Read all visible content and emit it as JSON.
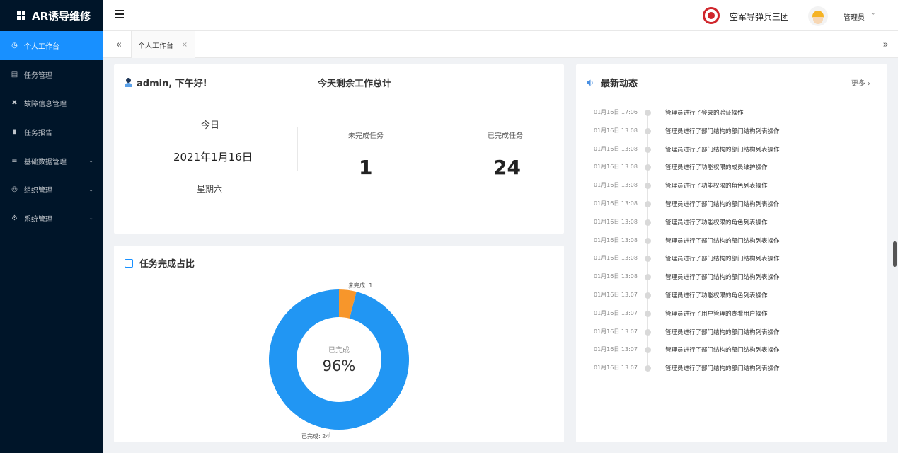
{
  "app": {
    "title": "AR诱导维修"
  },
  "sidebar": {
    "items": [
      {
        "label": "个人工作台",
        "icon": "dashboard-icon",
        "active": true,
        "has_children": false
      },
      {
        "label": "任务管理",
        "icon": "task-list-icon",
        "active": false,
        "has_children": false
      },
      {
        "label": "故障信息管理",
        "icon": "tools-icon",
        "active": false,
        "has_children": false
      },
      {
        "label": "任务报告",
        "icon": "bar-chart-icon",
        "active": false,
        "has_children": false
      },
      {
        "label": "基础数据管理",
        "icon": "sliders-icon",
        "active": false,
        "has_children": true
      },
      {
        "label": "组织管理",
        "icon": "org-icon",
        "active": false,
        "has_children": true
      },
      {
        "label": "系统管理",
        "icon": "gear-icon",
        "active": false,
        "has_children": true
      }
    ]
  },
  "header": {
    "unit_name": "空军导弹兵三团",
    "user_name": "管理员"
  },
  "tabs": [
    {
      "label": "个人工作台",
      "closable": true
    }
  ],
  "welcome": {
    "greeting": "admin, 下午好!",
    "summary_title": "今天剩余工作总计",
    "today_label": "今日",
    "date": "2021年1月16日",
    "weekday": "星期六",
    "unfinished_label": "未完成任务",
    "unfinished_value": "1",
    "finished_label": "已完成任务",
    "finished_value": "24"
  },
  "pie_card": {
    "title": "任务完成占比",
    "center_label": "已完成",
    "center_value": "96%",
    "label_unfinished": "未完成: 1",
    "label_finished": "已完成: 24"
  },
  "chart_data": {
    "type": "pie",
    "labels": [
      "已完成",
      "未完成"
    ],
    "values": [
      24,
      1
    ],
    "colors": [
      "#2196f3",
      "#f7962b"
    ]
  },
  "news": {
    "title": "最新动态",
    "more": "更多",
    "items": [
      {
        "time": "01月16日 17:06",
        "text": "管理员进行了登录的验证操作"
      },
      {
        "time": "01月16日 13:08",
        "text": "管理员进行了部门结构的部门结构列表操作"
      },
      {
        "time": "01月16日 13:08",
        "text": "管理员进行了部门结构的部门结构列表操作"
      },
      {
        "time": "01月16日 13:08",
        "text": "管理员进行了功能权限的成员维护操作"
      },
      {
        "time": "01月16日 13:08",
        "text": "管理员进行了功能权限的角色列表操作"
      },
      {
        "time": "01月16日 13:08",
        "text": "管理员进行了部门结构的部门结构列表操作"
      },
      {
        "time": "01月16日 13:08",
        "text": "管理员进行了功能权限的角色列表操作"
      },
      {
        "time": "01月16日 13:08",
        "text": "管理员进行了部门结构的部门结构列表操作"
      },
      {
        "time": "01月16日 13:08",
        "text": "管理员进行了部门结构的部门结构列表操作"
      },
      {
        "time": "01月16日 13:08",
        "text": "管理员进行了部门结构的部门结构列表操作"
      },
      {
        "time": "01月16日 13:07",
        "text": "管理员进行了功能权限的角色列表操作"
      },
      {
        "time": "01月16日 13:07",
        "text": "管理员进行了用户管理的查看用户操作"
      },
      {
        "time": "01月16日 13:07",
        "text": "管理员进行了部门结构的部门结构列表操作"
      },
      {
        "time": "01月16日 13:07",
        "text": "管理员进行了部门结构的部门结构列表操作"
      },
      {
        "time": "01月16日 13:07",
        "text": "管理员进行了部门结构的部门结构列表操作"
      }
    ]
  }
}
